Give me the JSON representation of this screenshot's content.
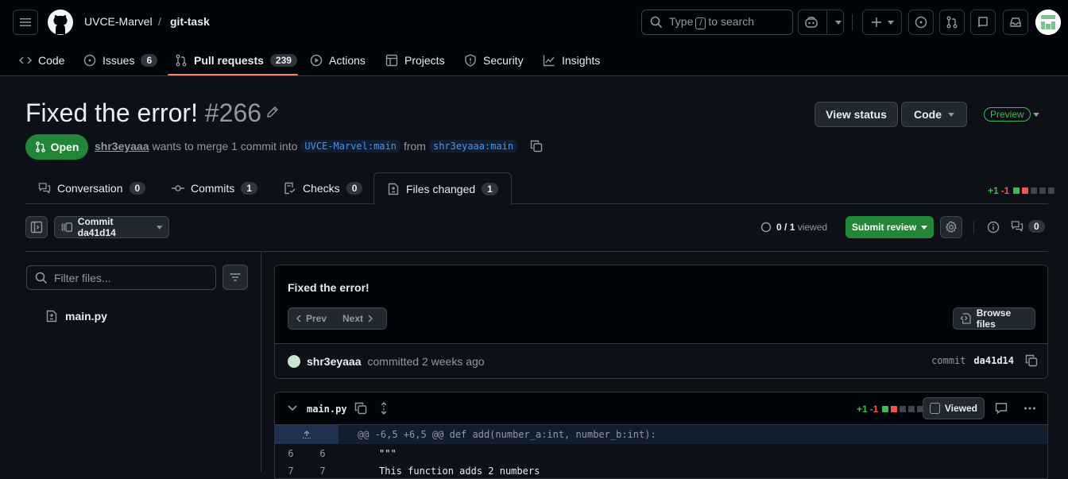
{
  "header": {
    "org": "UVCE-Marvel",
    "separator": "/",
    "repo": "git-task",
    "search_prefix": "Type",
    "search_key": "/",
    "search_suffix": "to search"
  },
  "nav": {
    "items": [
      {
        "label": "Code",
        "count": null
      },
      {
        "label": "Issues",
        "count": "6"
      },
      {
        "label": "Pull requests",
        "count": "239"
      },
      {
        "label": "Actions",
        "count": null
      },
      {
        "label": "Projects",
        "count": null
      },
      {
        "label": "Security",
        "count": null
      },
      {
        "label": "Insights",
        "count": null
      }
    ]
  },
  "pr": {
    "title": "Fixed the error!",
    "number": "#266",
    "state": "Open",
    "author": "shr3eyaaa",
    "meta_text": "wants to merge 1 commit into",
    "base_branch": "UVCE-Marvel:main",
    "from_text": "from",
    "head_branch": "shr3eyaaa:main",
    "view_status_label": "View status",
    "code_label": "Code",
    "preview_label": "Preview"
  },
  "tabs": [
    {
      "label": "Conversation",
      "count": "0"
    },
    {
      "label": "Commits",
      "count": "1"
    },
    {
      "label": "Checks",
      "count": "0"
    },
    {
      "label": "Files changed",
      "count": "1"
    }
  ],
  "diffstat": {
    "additions": "+1",
    "deletions": "-1"
  },
  "toolbar": {
    "commit_label": "Commit da41d14",
    "viewed_done": "0",
    "viewed_total": "/ 1",
    "viewed_label": "viewed",
    "submit_label": "Submit review",
    "comments_count": "0"
  },
  "sidebar": {
    "filter_placeholder": "Filter files...",
    "files": [
      "main.py"
    ]
  },
  "commit": {
    "message": "Fixed the error!",
    "prev_label": "Prev",
    "next_label": "Next",
    "browse_label": "Browse files",
    "author": "shr3eyaaa",
    "committed_text": "committed 2 weeks ago",
    "commit_word": "commit",
    "sha": "da41d14"
  },
  "file": {
    "name": "main.py",
    "additions": "+1",
    "deletions": "-1",
    "viewed_label": "Viewed",
    "hunk": "@@ -6,5 +6,5 @@ def add(number_a:int, number_b:int):",
    "lines": [
      {
        "old": "6",
        "new": "6",
        "code": "\"\"\""
      },
      {
        "old": "7",
        "new": "7",
        "code": "This function adds 2 numbers"
      }
    ]
  },
  "colors": {
    "accent_green": "#238636",
    "add_green": "#3fb950",
    "del_red": "#f85149",
    "link_blue": "#4493f8",
    "underline_orange": "#f78166"
  }
}
